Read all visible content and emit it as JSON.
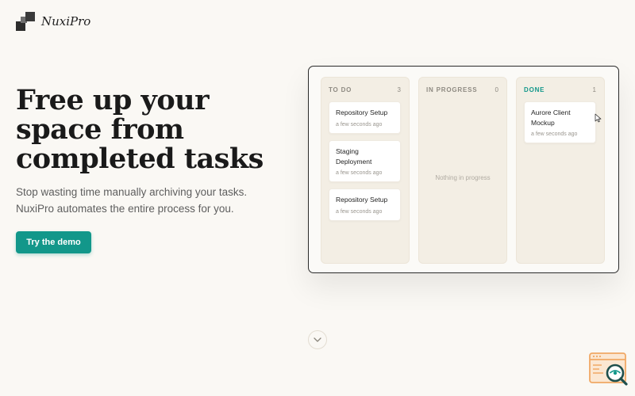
{
  "brand": {
    "name": "NuxiPro"
  },
  "hero": {
    "title": "Free up your space from completed tasks",
    "subtitle": "Stop wasting time manually archiving your tasks. NuxiPro automates the entire process for you.",
    "cta_label": "Try the demo"
  },
  "board": {
    "columns": [
      {
        "title": "TO DO",
        "count": "3",
        "cards": [
          {
            "title": "Repository Setup",
            "time": "a few seconds ago"
          },
          {
            "title": "Staging Deployment",
            "time": "a few seconds ago"
          },
          {
            "title": "Repository Setup",
            "time": "a few seconds ago"
          }
        ]
      },
      {
        "title": "IN PROGRESS",
        "count": "0",
        "empty_text": "Nothing in progress"
      },
      {
        "title": "DONE",
        "count": "1",
        "cards": [
          {
            "title": "Aurore Client Mockup",
            "time": "a few seconds ago"
          }
        ]
      }
    ]
  },
  "colors": {
    "accent": "#12978a",
    "background": "#faf8f4",
    "column_bg": "#f3eee4",
    "widget_orange": "#f0a865"
  },
  "icons": {
    "scroll": "chevron-down-icon",
    "widget": "search-analytics-icon",
    "cursor": "mouse-pointer-icon"
  }
}
